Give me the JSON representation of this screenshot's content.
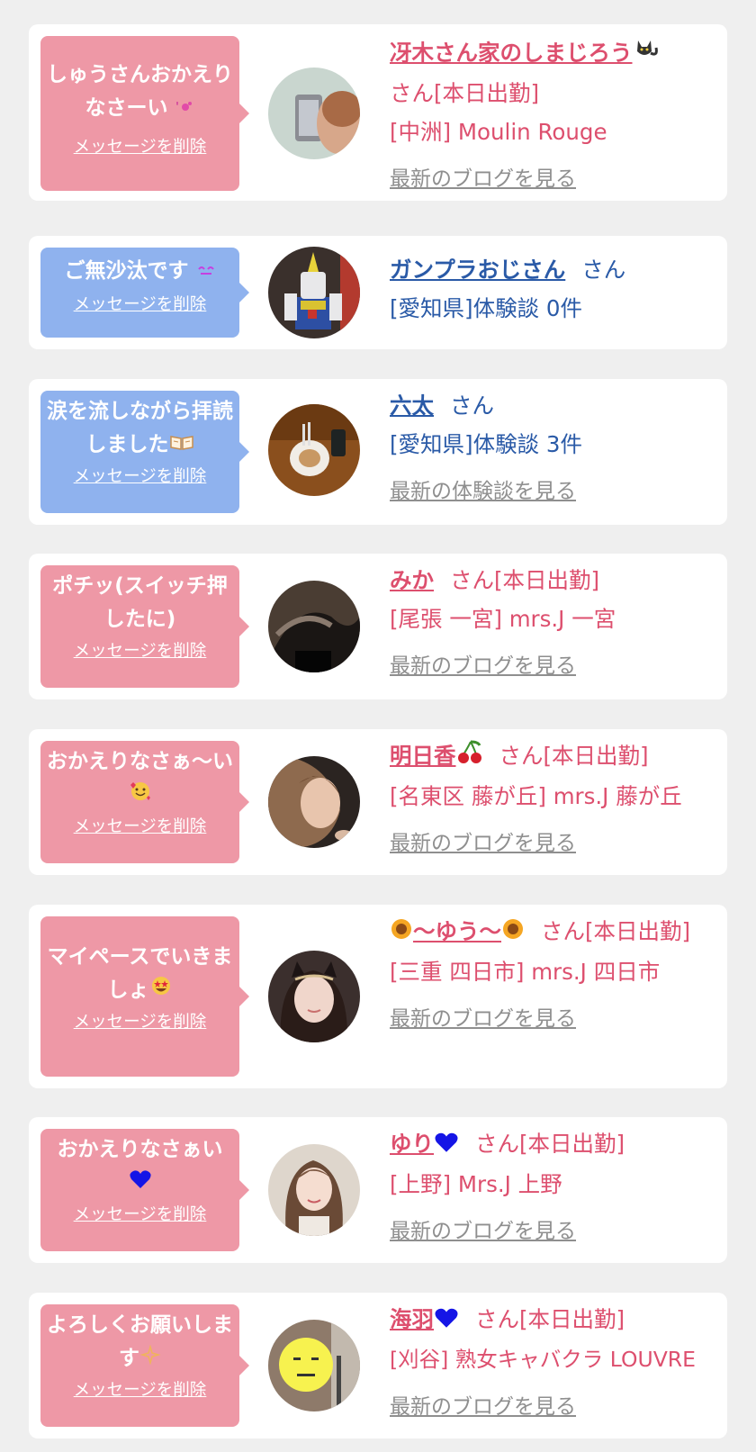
{
  "labels": {
    "delete_message": "メッセージを削除",
    "view_blog": "最新のブログを見る",
    "view_review": "最新の体験談を見る"
  },
  "items": [
    {
      "message": "しゅうさんおかえりなさーい",
      "emoji": "blow-kiss",
      "color": "pink",
      "name": "冴木さん家のしまじろう",
      "name_emoji": "black-cat",
      "suffix": "さん[本日出勤]",
      "shop": "[中洲] Moulin Rouge",
      "link": "最新のブログを見る"
    },
    {
      "message": "ご無沙汰です",
      "emoji": "smiling-eyes",
      "color": "blue",
      "name": "ガンプラおじさん",
      "suffix": "さん",
      "shop": "[愛知県]体験談 0件"
    },
    {
      "message": "涙を流しながら拝読しました",
      "emoji": "open-book",
      "color": "blue",
      "name": "六太",
      "suffix": "さん",
      "shop": "[愛知県]体験談 3件",
      "link": "最新の体験談を見る"
    },
    {
      "message": "ポチッ(スイッチ押したに)",
      "emoji": "",
      "color": "pink",
      "name": "みか",
      "suffix": "さん[本日出勤]",
      "shop": "[尾張 一宮] mrs.J 一宮",
      "link": "最新のブログを見る"
    },
    {
      "message": "おかえりなさぁ〜い",
      "emoji": "smiling-hearts",
      "color": "pink",
      "name": "明日香",
      "name_emoji": "cherries",
      "suffix": "さん[本日出勤]",
      "shop": "[名東区 藤が丘] mrs.J 藤が丘",
      "link": "最新のブログを見る"
    },
    {
      "message": "マイペースでいきましょ",
      "emoji": "star-struck",
      "color": "pink",
      "name": "〜ゆう〜",
      "name_emoji": "sunflower",
      "suffix": "さん[本日出勤]",
      "shop": "[三重 四日市] mrs.J 四日市",
      "link": "最新のブログを見る"
    },
    {
      "message": "おかえりなさぁい",
      "emoji": "blue-heart",
      "color": "pink",
      "name": "ゆり",
      "name_emoji": "blue-heart",
      "suffix": "さん[本日出勤]",
      "shop": "[上野] Mrs.J 上野",
      "link": "最新のブログを見る"
    },
    {
      "message": "よろしくお願いします",
      "emoji": "sparkles",
      "color": "pink",
      "name": "海羽",
      "name_emoji": "blue-heart",
      "suffix": "さん[本日出勤]",
      "shop": "[刈谷] 熟女キャバクラ LOUVRE",
      "link": "最新のブログを見る"
    }
  ],
  "colors": {
    "pink_bubble": "#ee98a6",
    "blue_bubble": "#8fb2ee",
    "pink_text": "#dd4f6e",
    "blue_text": "#2a5aa7",
    "link_gray": "#8f8f8f"
  }
}
